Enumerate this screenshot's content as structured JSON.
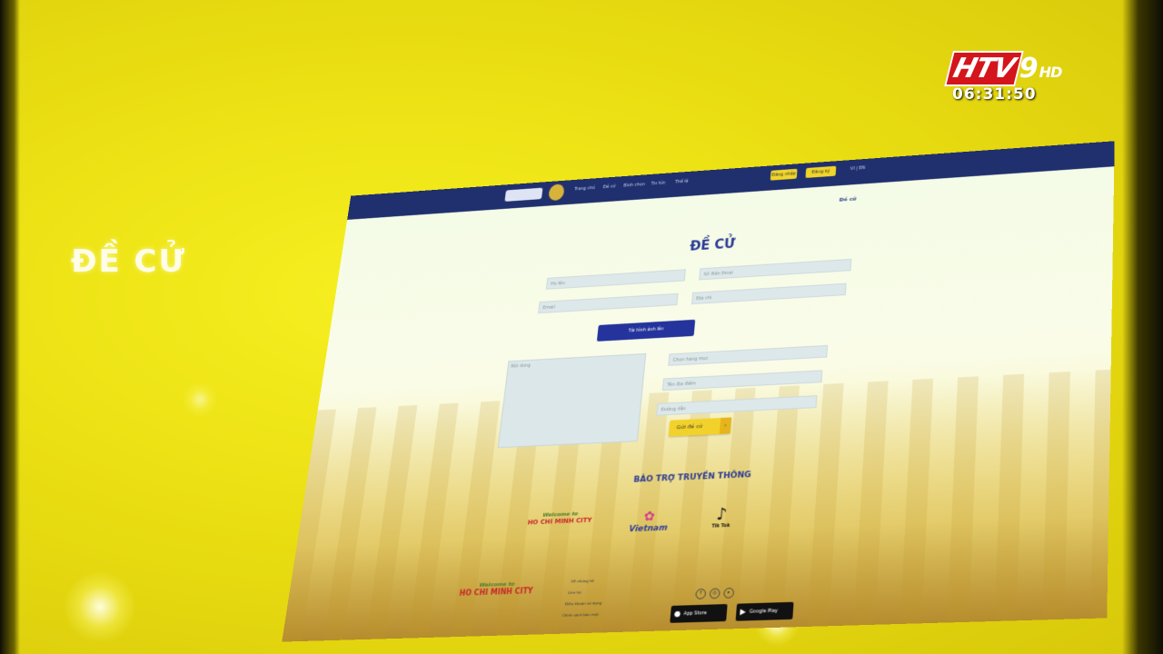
{
  "overlay": {
    "side_title": "ĐỀ CỬ",
    "channel_logo": {
      "htv": "HTV",
      "num": "9",
      "hd": "HD"
    },
    "clock": "06:31:50"
  },
  "site": {
    "nav": {
      "links": [
        "Trang chủ",
        "Đề cử",
        "Bình chọn",
        "Tin tức",
        "Thể lệ"
      ],
      "login": "Đăng nhập",
      "register": "Đăng ký",
      "lang": "VI | EN"
    },
    "breadcrumb": "Đề cử",
    "form": {
      "title": "ĐỀ CỬ",
      "fullname_placeholder": "Họ tên",
      "phone_placeholder": "Số điện thoại",
      "email_placeholder": "Email",
      "address_placeholder": "Địa chỉ",
      "upload_label": "Tải hình ảnh lên",
      "content_placeholder": "Nội dung",
      "select_value": "Chọn hạng mục",
      "place_placeholder": "Tên địa điểm",
      "link_placeholder": "Đường dẫn",
      "submit_label": "Gửi đề cử"
    },
    "media": {
      "title": "BẢO TRỢ TRUYỀN THÔNG",
      "hcm_script": "Welcome to",
      "hcm_name": "HO CHI MINH CITY",
      "vietnam": "Vietnam",
      "tiktok": "Tik Tok"
    },
    "footer": {
      "hcm_script": "Welcome to",
      "hcm_name": "HO CHI MINH CITY",
      "links": [
        "Về chúng tôi",
        "Liên hệ",
        "Điều khoản sử dụng",
        "Chính sách bảo mật"
      ],
      "app_store": "App Store",
      "google_play": "Google Play"
    }
  },
  "colors": {
    "navbar": "#20306e",
    "accent_blue": "#24349c",
    "accent_yellow": "#f2d22a",
    "stage_yellow": "#eadf12"
  }
}
